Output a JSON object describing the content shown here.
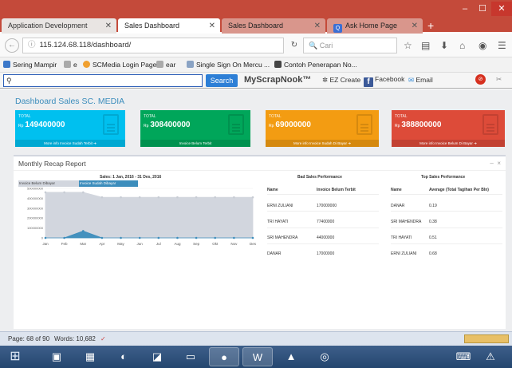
{
  "browser": {
    "tabs": [
      {
        "label": "Application Development"
      },
      {
        "label": "Sales Dashboard"
      },
      {
        "label": "Sales Dashboard"
      },
      {
        "label": "Ask Home Page"
      }
    ],
    "url": "115.124.68.118/dashboard/",
    "search_placeholder": "Cari",
    "bookmarks": [
      "Sering Mampir",
      "e",
      "SCMedia Login Page",
      "ear",
      "Single Sign On Mercu ...",
      "Contoh Penerapan No..."
    ]
  },
  "toolbar": {
    "search_value": "",
    "search_button": "Search",
    "logo": "MyScrapNook™",
    "items": [
      "EZ Create",
      "Facebook",
      "Email"
    ]
  },
  "dashboard": {
    "title": "Dashboard Sales SC. MEDIA",
    "cards": [
      {
        "label": "TOTAL",
        "currency": "Rp",
        "value": "149400000",
        "footer": "More info Invoice Sudah Terbit",
        "color": "#00c0ef"
      },
      {
        "label": "TOTAL",
        "currency": "Rp",
        "value": "308400000",
        "footer": "Invoice Belum Terbit",
        "color": "#00a65a"
      },
      {
        "label": "TOTAL",
        "currency": "Rp",
        "value": "69000000",
        "footer": "More info Invoice Sudah Di Bayar",
        "color": "#f39c12"
      },
      {
        "label": "TOTAL",
        "currency": "Rp",
        "value": "388800000",
        "footer": "More info Invoice Belum Di Bayar",
        "color": "#dd4b39"
      }
    ],
    "recap": {
      "title": "Monthly Recap Report",
      "chart_title": "Sales: 1 Jan, 2016 - 31 Dec, 2016",
      "legend": [
        "Invoice Belum Dibayar",
        "Invoice Sudah Dibayar"
      ]
    },
    "bad_sales": {
      "title": "Bad Sales Performance",
      "headers": [
        "Name",
        "Invoice Belum Terbit"
      ],
      "rows": [
        [
          "ERNI ZULIANI",
          "170000000"
        ],
        [
          "TRI HAYATI",
          "77400000"
        ],
        [
          "SRI MAHENDRA",
          "44000000"
        ],
        [
          "DANAR",
          "17000000"
        ]
      ]
    },
    "top_sales": {
      "title": "Top Sales Performance",
      "headers": [
        "Name",
        "Average (Total Tagihan Per Bln)"
      ],
      "rows": [
        [
          "DANAR",
          "0.19"
        ],
        [
          "SRI MAHENDRA",
          "0.38"
        ],
        [
          "TRI HAYATI",
          "0.51"
        ],
        [
          "ERNI ZULIANI",
          "0.68"
        ]
      ]
    }
  },
  "chart_data": {
    "type": "area",
    "title": "Sales: 1 Jan, 2016 - 31 Des, 2016",
    "categories": [
      "Jan",
      "Feb",
      "Mar",
      "Apr",
      "May",
      "Jun",
      "Jul",
      "Aug",
      "Sep",
      "Okt",
      "Nov",
      "Des"
    ],
    "y_ticks": [
      "500000000",
      "400000000",
      "300000000",
      "200000000",
      "100000000",
      "0"
    ],
    "ylim": [
      0,
      500000000
    ],
    "series": [
      {
        "name": "Invoice Belum Dibayar",
        "color": "#d2d6de",
        "values": [
          460000000,
          460000000,
          460000000,
          410000000,
          410000000,
          410000000,
          410000000,
          410000000,
          410000000,
          410000000,
          410000000,
          410000000
        ]
      },
      {
        "name": "Invoice Sudah Dibayar",
        "color": "#3c8dbc",
        "values": [
          0,
          0,
          69000000,
          0,
          0,
          0,
          0,
          0,
          0,
          0,
          0,
          0
        ]
      }
    ]
  },
  "status": {
    "page": "Page: 68 of 90",
    "words": "Words: 10,682"
  }
}
